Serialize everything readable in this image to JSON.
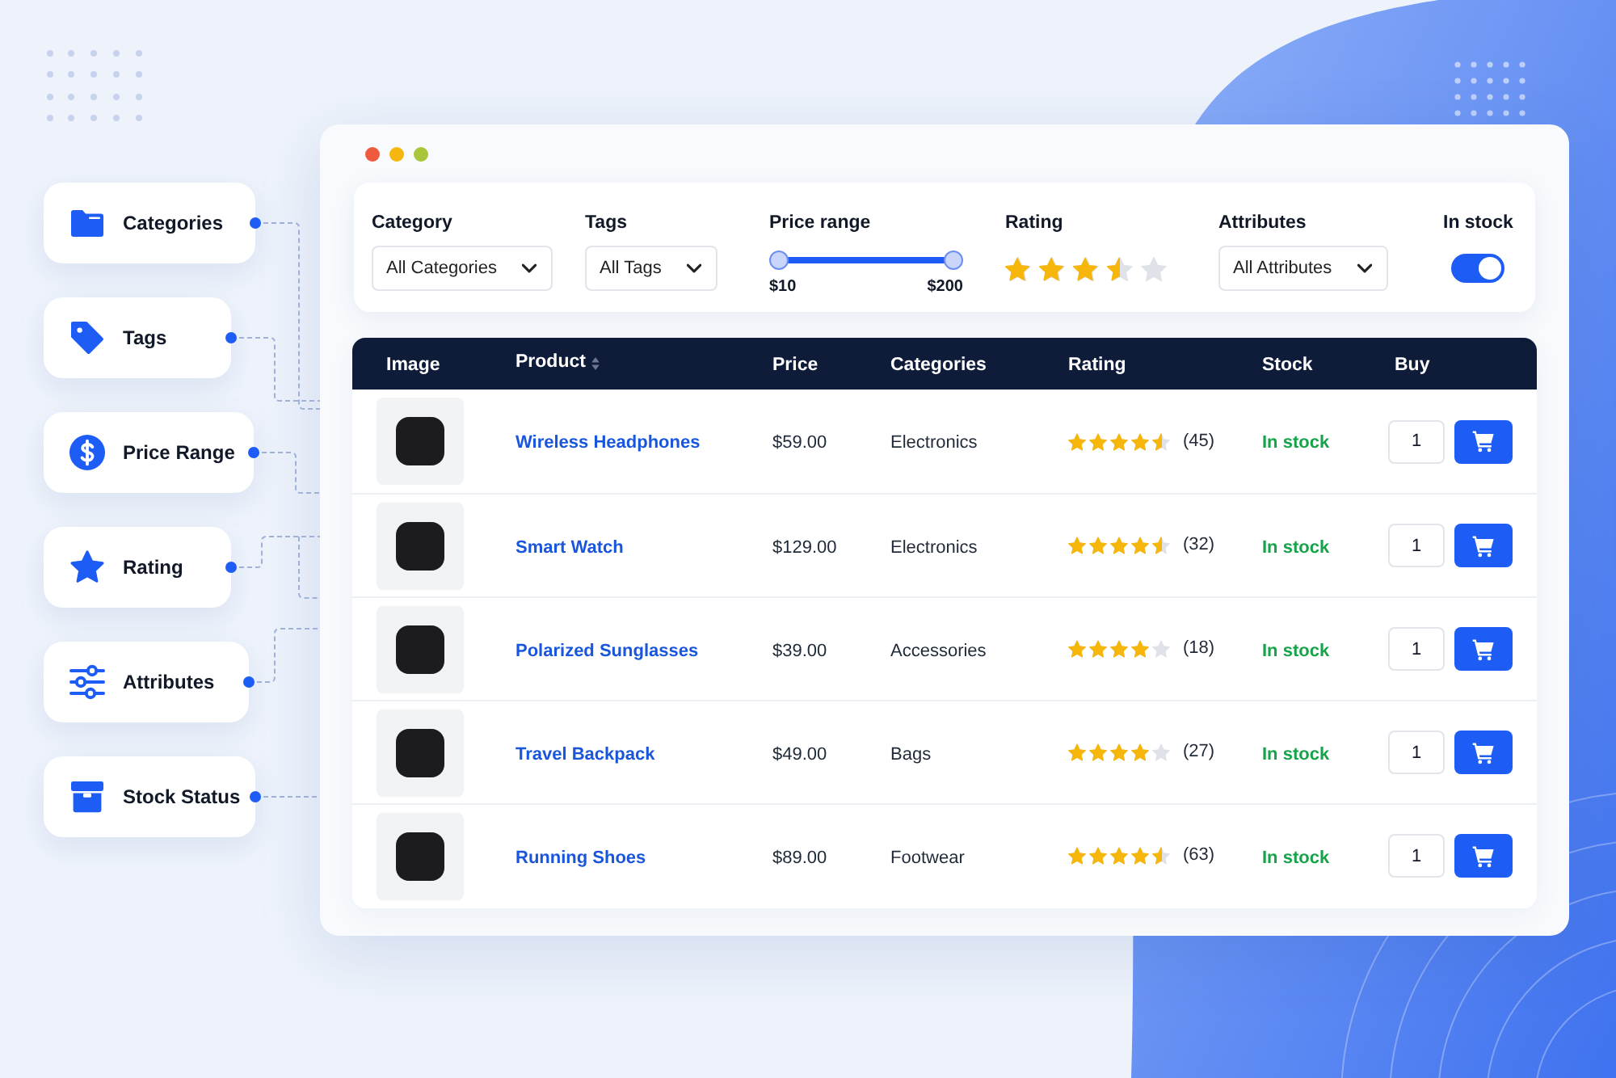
{
  "features": [
    {
      "label": "Categories"
    },
    {
      "label": "Tags"
    },
    {
      "label": "Price Range"
    },
    {
      "label": "Rating"
    },
    {
      "label": "Attributes"
    },
    {
      "label": "Stock Status"
    }
  ],
  "filters": [
    {
      "kind": "select",
      "label": "Category",
      "value": "All Categories"
    },
    {
      "kind": "select",
      "label": "Tags",
      "value": "All Tags"
    },
    {
      "kind": "range",
      "label": "Price range",
      "level": 1,
      "min": "$10",
      "max": "$200"
    },
    {
      "kind": "stars",
      "label": "Rating",
      "stars": 3.5
    },
    {
      "kind": "select",
      "label": "Attributes",
      "value": "All Attributes"
    },
    {
      "kind": "toggle",
      "label": "In stock",
      "on": true
    }
  ],
  "table": {
    "columns": [
      {
        "label": "Image",
        "sortable": false
      },
      {
        "label": "Product",
        "sortable": true
      },
      {
        "label": "Price",
        "sortable": false
      },
      {
        "label": "Categories",
        "sortable": false
      },
      {
        "label": "Rating",
        "sortable": false
      },
      {
        "label": "Stock",
        "sortable": false
      },
      {
        "label": "Buy",
        "sortable": false
      }
    ],
    "rows": [
      {
        "product": "Wireless Headphones",
        "price": "$59.00",
        "category": "Electronics",
        "stars": 4.5,
        "reviews": "(45)",
        "stock": "In stock",
        "quantity": "1"
      },
      {
        "product": "Smart Watch",
        "price": "$129.00",
        "category": "Electronics",
        "stars": 4.5,
        "reviews": "(32)",
        "stock": "In stock",
        "quantity": "1"
      },
      {
        "product": "Polarized Sunglasses",
        "price": "$39.00",
        "category": "Accessories",
        "stars": 4,
        "reviews": "(18)",
        "stock": "In stock",
        "quantity": "1"
      },
      {
        "product": "Travel Backpack",
        "price": "$49.00",
        "category": "Bags",
        "stars": 4,
        "reviews": "(27)",
        "stock": "In stock",
        "quantity": "1"
      },
      {
        "product": "Running Shoes",
        "price": "$89.00",
        "category": "Footwear",
        "stars": 4.5,
        "reviews": "(63)",
        "stock": "In stock",
        "quantity": "1"
      }
    ]
  }
}
